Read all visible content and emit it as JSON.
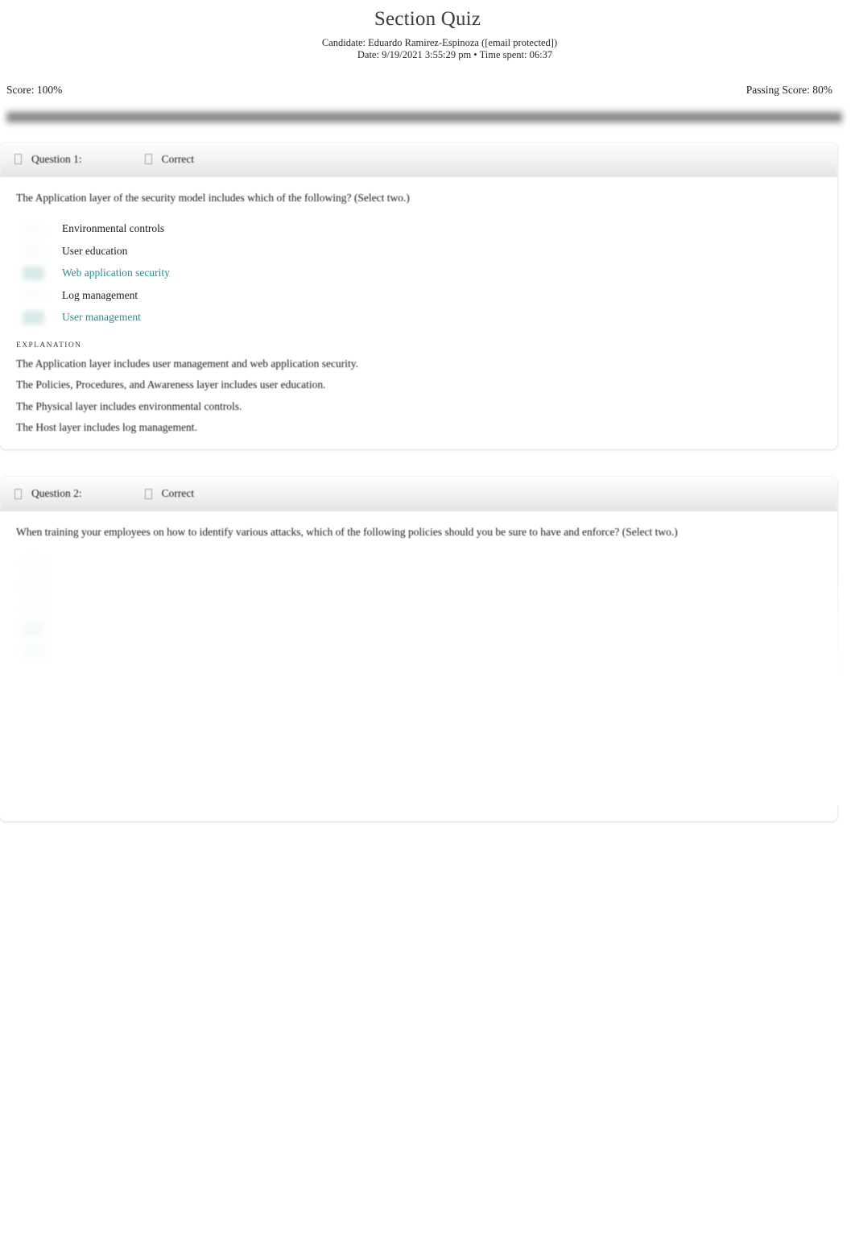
{
  "header": {
    "title": "Section Quiz",
    "candidate": "Candidate: Eduardo Ramirez-Espinoza ([email protected])",
    "date": "Date: 9/19/2021 3:55:29 pm • Time spent: 06:37"
  },
  "score": {
    "score_label": "Score: 100%",
    "passing_label": "Passing Score: 80%",
    "score_percent": 100,
    "passing_percent": 80,
    "bar_color": "#6f6f6f"
  },
  "colors": {
    "correct_text": "#2f8a8a",
    "correct_badge": "#d7e9e8",
    "body_text": "#1b1b1b",
    "header_band": "#f2f2f2"
  },
  "questions": [
    {
      "label": "Question 1:",
      "status": "Correct",
      "status_icon": "check-icon",
      "question_icon": "question-icon",
      "text": "The Application layer of the security model includes which of the following? (Select two.)",
      "answers": [
        {
          "text": "Environmental controls",
          "selected": false
        },
        {
          "text": "User education",
          "selected": false
        },
        {
          "text": "Web application security",
          "selected": true
        },
        {
          "text": "Log management",
          "selected": false
        },
        {
          "text": "User management",
          "selected": true
        }
      ],
      "explanation_label": "EXPLANATION",
      "explanation_lines": [
        "The Application layer includes user management and web application security.",
        "The Policies, Procedures, and Awareness layer includes user education.",
        "The Physical layer includes environmental controls.",
        "The Host layer includes log management."
      ]
    },
    {
      "label": "Question 2:",
      "status": "Correct",
      "status_icon": "check-icon",
      "question_icon": "question-icon",
      "text": "When training your employees on how to identify various attacks, which of the following policies should you be sure to have and enforce? (Select two.)",
      "answers": [
        {
          "text": "",
          "selected": false
        },
        {
          "text": "",
          "selected": false
        },
        {
          "text": "",
          "selected": false
        },
        {
          "text": "",
          "selected": true
        },
        {
          "text": "",
          "selected": true
        }
      ]
    }
  ]
}
